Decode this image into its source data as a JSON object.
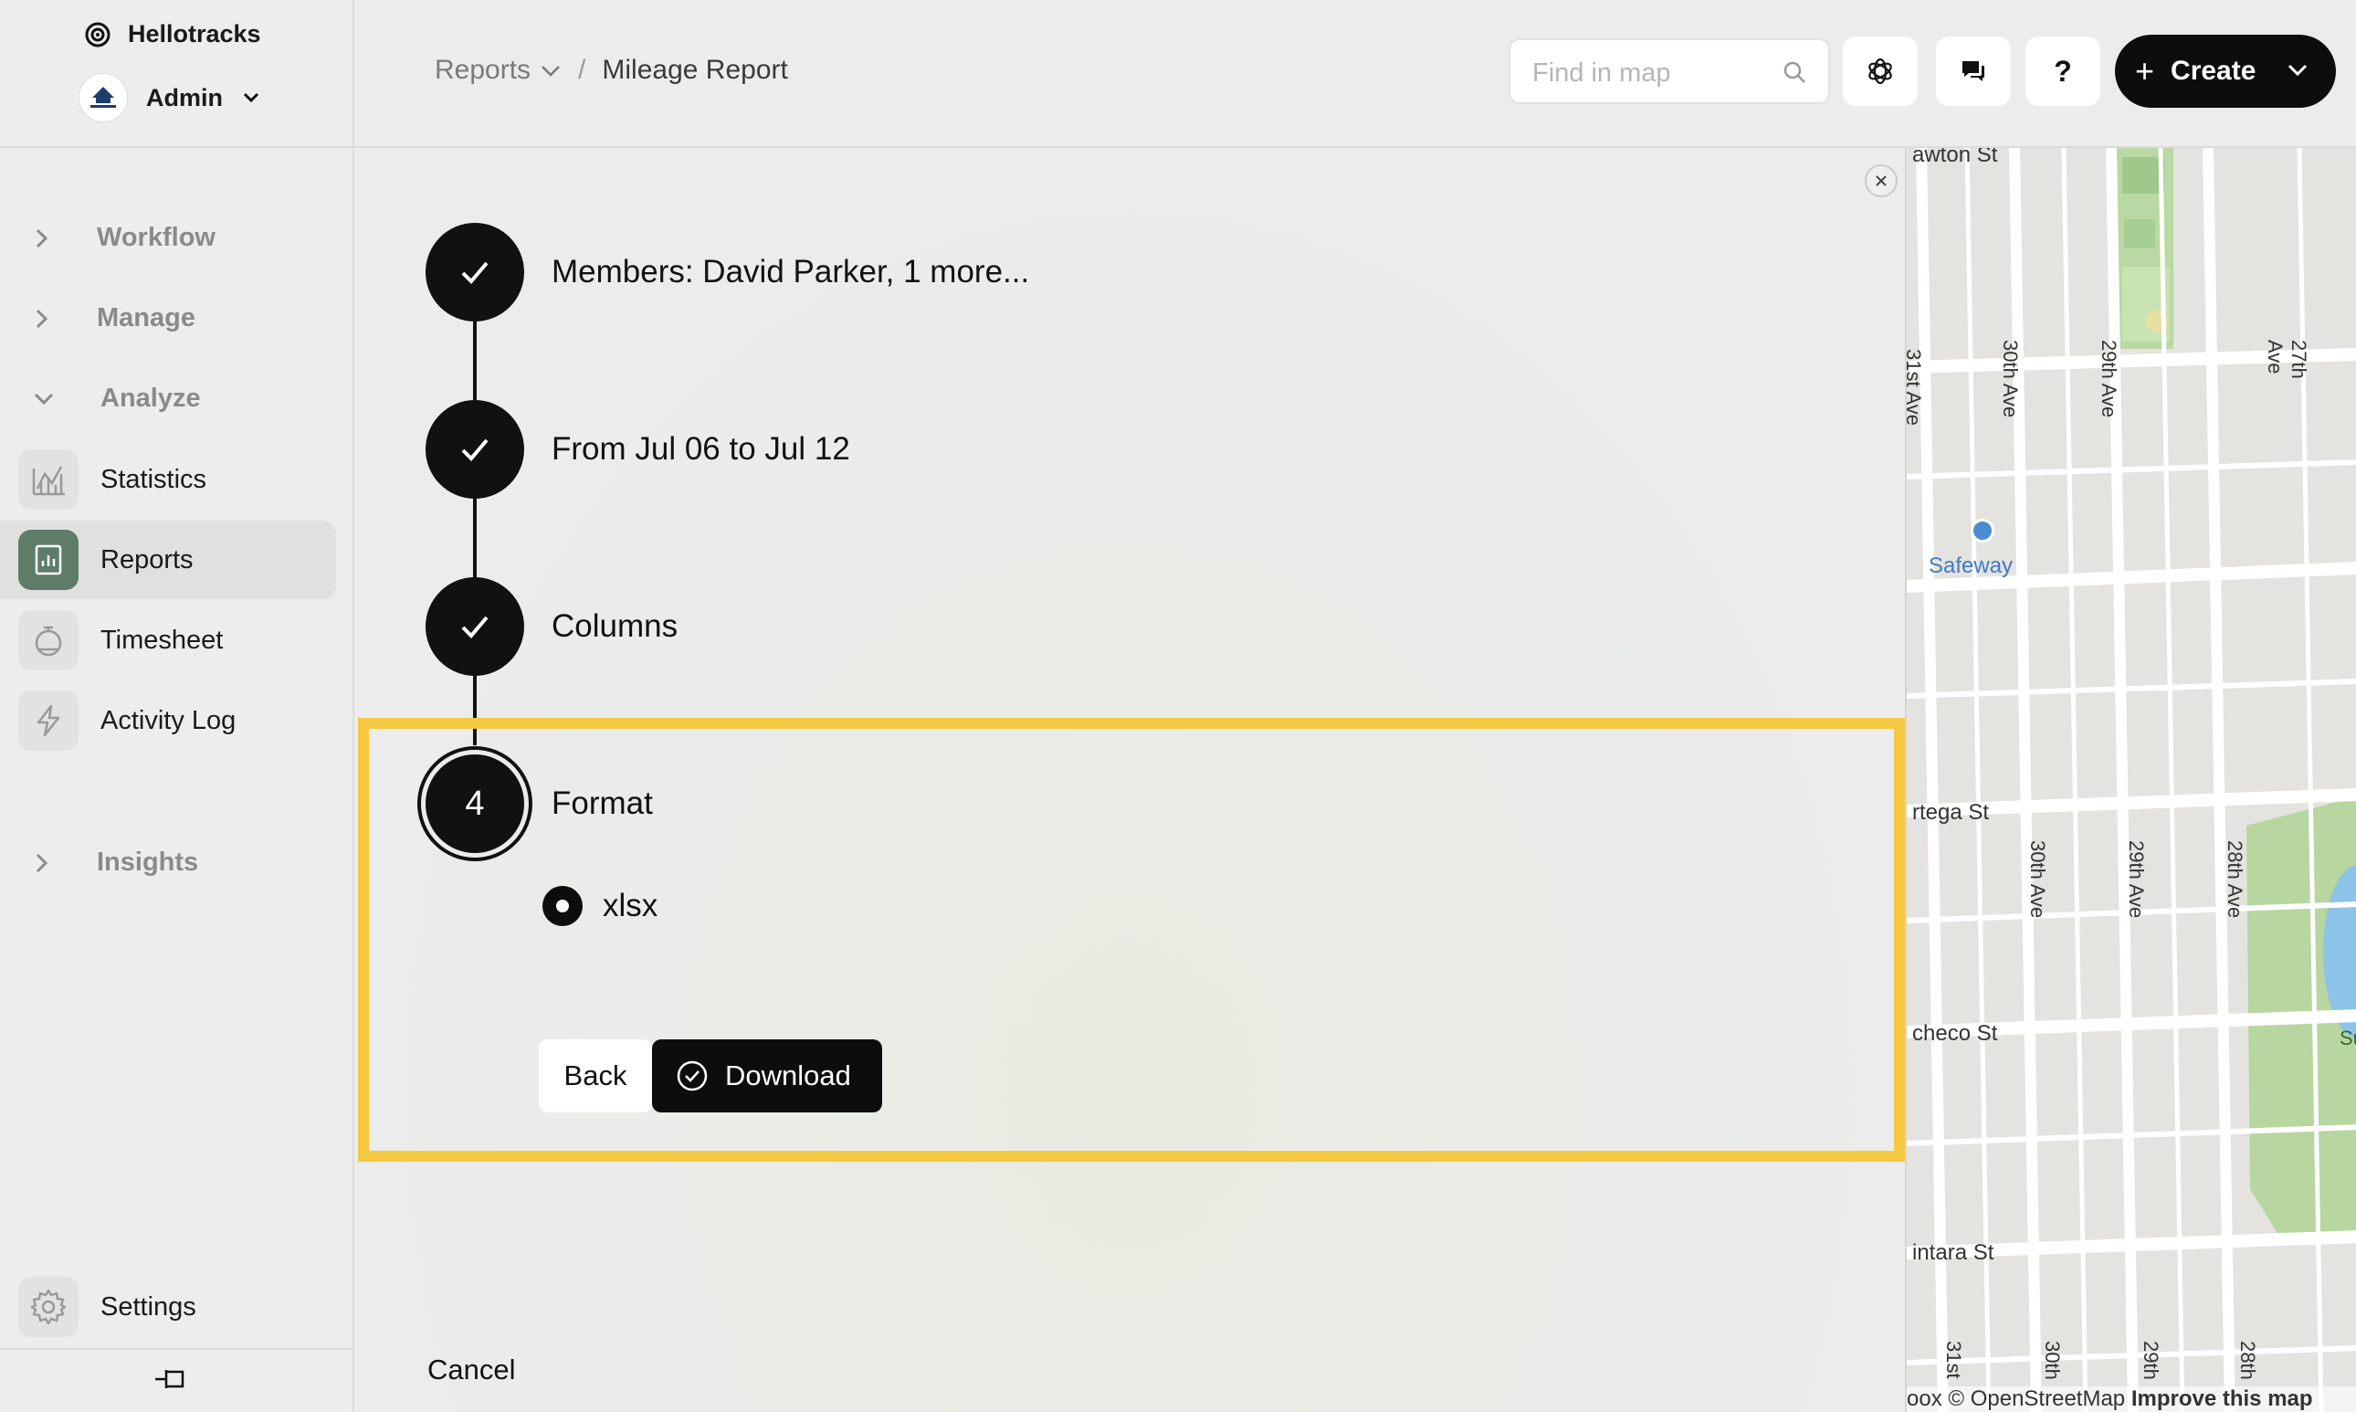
{
  "app": {
    "name": "Hellotracks"
  },
  "org": {
    "name": "Admin"
  },
  "sidebar": {
    "groups": [
      {
        "label": "Workflow",
        "expanded": false
      },
      {
        "label": "Manage",
        "expanded": false
      },
      {
        "label": "Analyze",
        "expanded": true
      }
    ],
    "items": [
      {
        "label": "Statistics",
        "icon": "chart-icon"
      },
      {
        "label": "Reports",
        "icon": "report-icon",
        "active": true
      },
      {
        "label": "Timesheet",
        "icon": "timer-icon"
      },
      {
        "label": "Activity Log",
        "icon": "bolt-icon"
      }
    ],
    "insights": "Insights",
    "settings": "Settings"
  },
  "header": {
    "breadcrumb_parent": "Reports",
    "breadcrumb_separator": "/",
    "breadcrumb_current": "Mileage Report",
    "search_placeholder": "Find in map",
    "help_label": "?",
    "create_label": "Create",
    "create_plus": "+"
  },
  "wizard": {
    "steps": [
      {
        "label": "Members: David Parker, 1 more...",
        "status": "done"
      },
      {
        "label": "From Jul 06 to Jul 12",
        "status": "done"
      },
      {
        "label": "Columns",
        "status": "done"
      },
      {
        "label": "Format",
        "status": "current",
        "number": "4"
      }
    ],
    "format_option": "xlsx",
    "back_label": "Back",
    "download_label": "Download",
    "cancel_label": "Cancel"
  },
  "map": {
    "streets": [
      "awton St",
      "31st Ave",
      "30th Ave",
      "29th Ave",
      "27th Ave",
      "rtega St",
      "30th Ave",
      "29th Ave",
      "28th Ave",
      "checo St",
      "intara St",
      "31st",
      "30th",
      "29th",
      "28th"
    ],
    "poi": "Safeway",
    "park_label": "Su",
    "attribution_prefix": "oox © OpenStreetMap",
    "attribution_link": "Improve this map"
  },
  "colors": {
    "highlight": "#f5c842",
    "accent_active": "#5d7d69",
    "primary": "#0d0d0d"
  }
}
